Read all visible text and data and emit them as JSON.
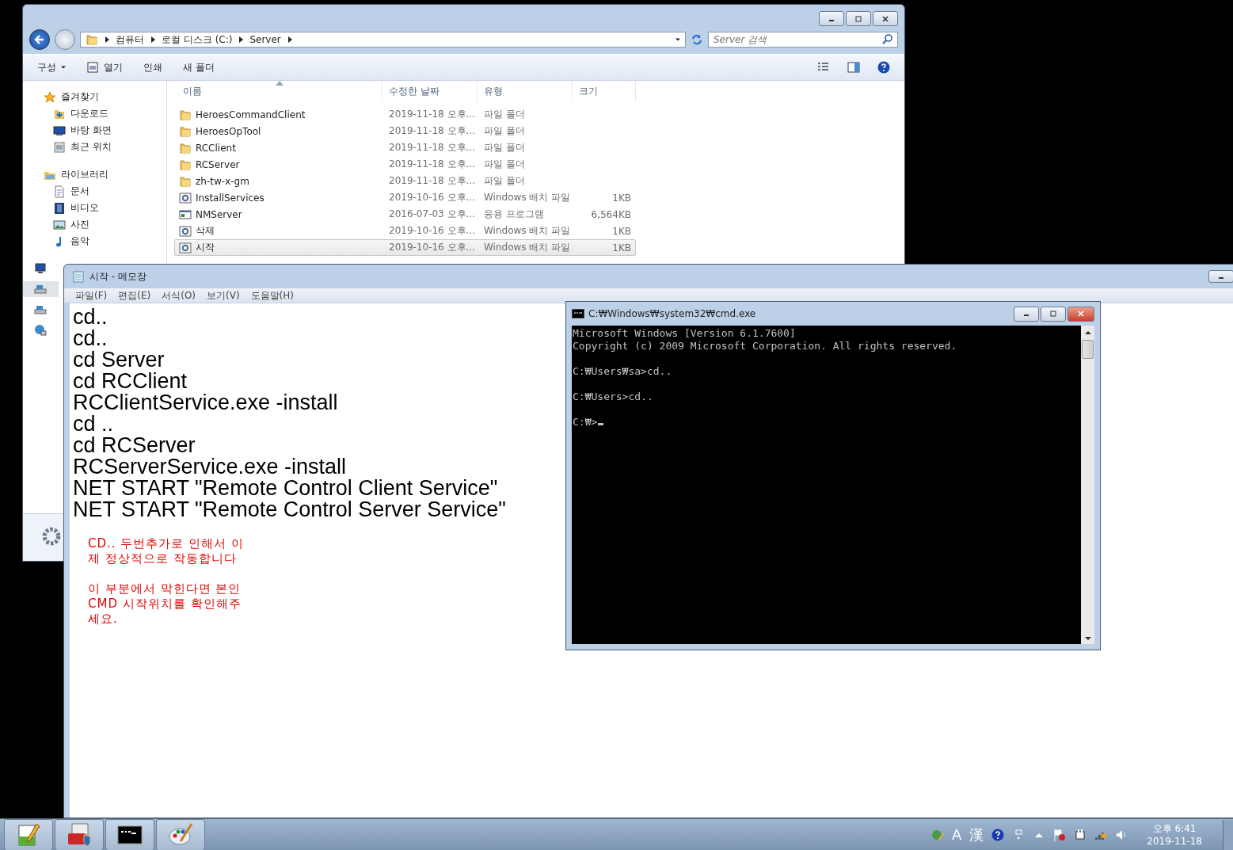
{
  "explorer": {
    "breadcrumb": [
      "컴퓨터",
      "로컬 디스크 (C:)",
      "Server"
    ],
    "search": {
      "placeholder": "Server 검색"
    },
    "toolbar": [
      {
        "label": "구성",
        "kind": "menu"
      },
      {
        "label": "열기",
        "kind": "open"
      },
      {
        "label": "인쇄",
        "kind": "plain"
      },
      {
        "label": "새 폴더",
        "kind": "plain"
      }
    ],
    "nav": [
      {
        "label": "즐겨찾기",
        "kind": "star",
        "children": [
          {
            "label": "다운로드",
            "kind": "download"
          },
          {
            "label": "바탕 화면",
            "kind": "desktop"
          },
          {
            "label": "최근 위치",
            "kind": "recent"
          }
        ]
      },
      {
        "label": "라이브러리",
        "kind": "library",
        "children": [
          {
            "label": "문서",
            "kind": "document"
          },
          {
            "label": "비디오",
            "kind": "video"
          },
          {
            "label": "사진",
            "kind": "picture"
          },
          {
            "label": "음악",
            "kind": "music"
          }
        ]
      }
    ],
    "nav_hidden": [
      {
        "kind": "computer",
        "selected": false
      },
      {
        "kind": "drive",
        "selected": true
      },
      {
        "kind": "drive",
        "selected": false
      },
      {
        "kind": "network",
        "selected": false
      }
    ],
    "columns": [
      {
        "label": "이름",
        "sorted": true
      },
      {
        "label": "수정한 날짜",
        "sorted": false
      },
      {
        "label": "유형",
        "sorted": false
      },
      {
        "label": "크기",
        "sorted": false
      }
    ],
    "files": [
      {
        "name": "HeroesCommandClient",
        "date": "2019-11-18 오후...",
        "type": "파일 폴더",
        "kind": "folder",
        "selected": false
      },
      {
        "name": "HeroesOpTool",
        "date": "2019-11-18 오후...",
        "type": "파일 폴더",
        "kind": "folder",
        "selected": false
      },
      {
        "name": "RCClient",
        "date": "2019-11-18 오후...",
        "type": "파일 폴더",
        "kind": "folder",
        "selected": false
      },
      {
        "name": "RCServer",
        "date": "2019-11-18 오후...",
        "type": "파일 폴더",
        "kind": "folder",
        "selected": false
      },
      {
        "name": "zh-tw-x-gm",
        "date": "2019-11-18 오후...",
        "type": "파일 폴더",
        "kind": "folder",
        "selected": false
      },
      {
        "name": "InstallServices",
        "date": "2019-10-16 오후...",
        "type": "Windows 배치 파일",
        "size": "1KB",
        "kind": "batch",
        "selected": false
      },
      {
        "name": "NMServer",
        "date": "2016-07-03 오후...",
        "type": "응용 프로그램",
        "size": "6,564KB",
        "kind": "app",
        "selected": false
      },
      {
        "name": "삭제",
        "date": "2019-10-16 오후...",
        "type": "Windows 배치 파일",
        "size": "1KB",
        "kind": "batch",
        "selected": false
      },
      {
        "name": "시작",
        "date": "2019-10-16 오후...",
        "type": "Windows 배치 파일",
        "size": "1KB",
        "kind": "batch",
        "selected": true
      }
    ]
  },
  "notepad": {
    "title": "시작 - 메모장",
    "menu": [
      "파일(F)",
      "편집(E)",
      "서식(O)",
      "보기(V)",
      "도움말(H)"
    ],
    "lines": [
      "cd..",
      "cd..",
      "cd Server",
      "cd RCClient",
      "RCClientService.exe -install",
      "cd ..",
      "cd RCServer",
      "RCServerService.exe -install",
      "NET START \"Remote Control Client Service\"",
      "NET START \"Remote Control Server Service\""
    ],
    "notes": [
      {
        "lines": [
          "CD.. 두번추가로 인해서 이",
          "제 정상적으로 작동합니다"
        ]
      },
      {
        "lines": [
          "이 부분에서 막힌다면 본인",
          "CMD 시작위치를 확인해주",
          "세요."
        ]
      }
    ]
  },
  "cmd": {
    "title": "C:₩Windows₩system32₩cmd.exe",
    "blocks": [
      [
        "Microsoft Windows [Version 6.1.7600]",
        "Copyright (c) 2009 Microsoft Corporation. All rights reserved."
      ],
      [
        "C:₩Users₩sa>cd.."
      ],
      [
        "C:₩Users>cd.."
      ],
      [
        "C:₩>"
      ]
    ]
  },
  "taskbar": {
    "apps": [
      {
        "kind": "notepadpp"
      },
      {
        "kind": "toolbox"
      },
      {
        "kind": "console"
      },
      {
        "kind": "paint"
      }
    ],
    "ime": [
      "A",
      "漢"
    ],
    "clock": {
      "time": "오후 6:41",
      "date": "2019-11-18"
    }
  }
}
